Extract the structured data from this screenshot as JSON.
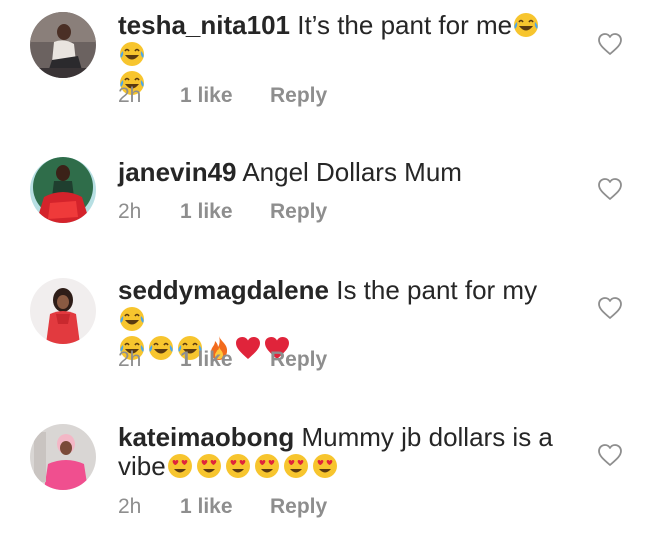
{
  "comments": [
    {
      "username": "tesha_nita101",
      "text": "It’s the pant for me",
      "time": "2h",
      "likes": "1 like",
      "reply": "Reply",
      "emojis": [
        "face-with-tears-of-joy",
        "face-with-tears-of-joy",
        "face-with-tears-of-joy"
      ]
    },
    {
      "username": "janevin49",
      "text": "Angel Dollars Mum",
      "time": "2h",
      "likes": "1 like",
      "reply": "Reply",
      "emojis": []
    },
    {
      "username": "seddymagdalene",
      "text": "Is the pant for my",
      "time": "2h",
      "likes": "1 like",
      "reply": "Reply",
      "emojis": [
        "face-with-tears-of-joy",
        "face-with-tears-of-joy",
        "face-with-tears-of-joy",
        "face-with-tears-of-joy",
        "fire",
        "red-heart",
        "red-heart"
      ]
    },
    {
      "username": "kateimaobong",
      "text": "Mummy jb dollars is a vibe",
      "time": "2h",
      "likes": "1 like",
      "reply": "Reply",
      "emojis": [
        "smiling-face-with-heart-eyes",
        "smiling-face-with-heart-eyes",
        "smiling-face-with-heart-eyes",
        "smiling-face-with-heart-eyes",
        "smiling-face-with-heart-eyes",
        "smiling-face-with-heart-eyes"
      ]
    }
  ],
  "colors": {
    "text": "#262626",
    "meta": "#8e8e8e",
    "heart_outline": "#8e8e8e",
    "emoji_heart": "#e0243b"
  }
}
